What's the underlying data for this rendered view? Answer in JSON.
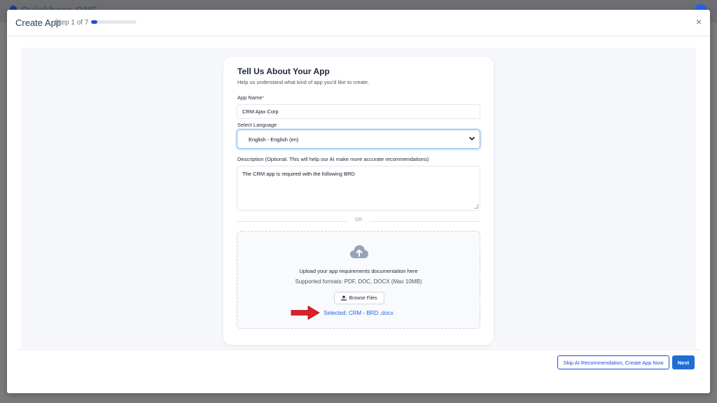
{
  "background": {
    "brand": "Quickbase ONE"
  },
  "modal": {
    "title": "Create App",
    "step": "Step 1 of 7",
    "progress": 0.143,
    "close": "×"
  },
  "form": {
    "title": "Tell Us About Your App",
    "subtitle": "Help us understand what kind of app you'd like to create.",
    "app_name_label": "App Name",
    "app_name_required": "*",
    "app_name_value": "CRM Ajax Corp",
    "language_label": "Select Language",
    "language_value": "English - English (en)",
    "description_label": "Description (Optional. This will help our AI make more accurate recommendations)",
    "description_value": "The CRM app is required with the following BRD",
    "divider": "OR"
  },
  "upload": {
    "title": "Upload your app requirements documentation here",
    "formats": "Supported formats: PDF, DOC, DOCX (Max 10MB)",
    "browse_label": "Browse Files",
    "selected": "Selected: CRM - BRD .docx"
  },
  "footer": {
    "skip_label": "Skip AI Recommendation, Create App Now",
    "next_label": "Next"
  },
  "colors": {
    "primary": "#1d4ed8",
    "annotation_arrow": "#e11d2a"
  },
  "icons": [
    "cloud-upload-icon",
    "upload-icon",
    "chevron-down-icon",
    "close-icon",
    "red-arrow-annotation"
  ]
}
